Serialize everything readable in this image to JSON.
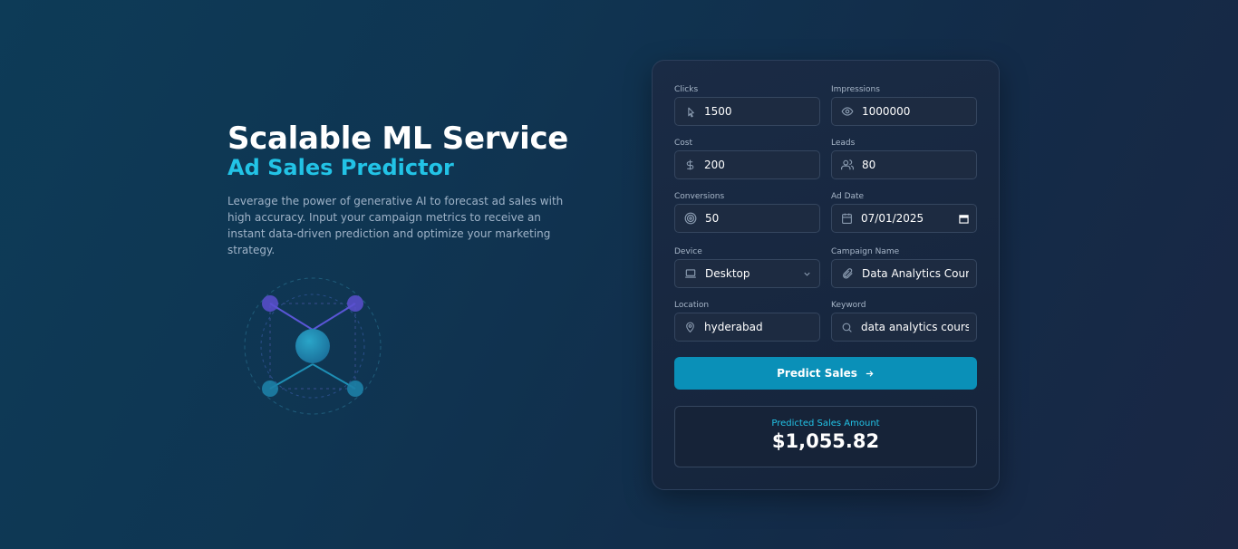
{
  "hero": {
    "title": "Scalable ML Service",
    "subtitle": "Ad Sales Predictor",
    "description": "Leverage the power of generative AI to forecast ad sales with high accuracy. Input your campaign metrics to receive an instant data-driven prediction and optimize your marketing strategy."
  },
  "form": {
    "clicks": {
      "label": "Clicks",
      "value": "1500",
      "icon": "pointer-icon"
    },
    "impressions": {
      "label": "Impressions",
      "value": "1000000",
      "icon": "eye-icon"
    },
    "cost": {
      "label": "Cost",
      "value": "200",
      "icon": "dollar-icon"
    },
    "leads": {
      "label": "Leads",
      "value": "80",
      "icon": "users-icon"
    },
    "conversions": {
      "label": "Conversions",
      "value": "50",
      "icon": "target-icon"
    },
    "ad_date": {
      "label": "Ad Date",
      "value": "07/01/2025",
      "icon": "calendar-icon"
    },
    "device": {
      "label": "Device",
      "value": "Desktop",
      "icon": "laptop-icon"
    },
    "campaign_name": {
      "label": "Campaign Name",
      "value": "Data Analytics Course",
      "icon": "paperclip-icon"
    },
    "location": {
      "label": "Location",
      "value": "hyderabad",
      "icon": "map-pin-icon"
    },
    "keyword": {
      "label": "Keyword",
      "value": "data analytics course",
      "icon": "search-icon"
    }
  },
  "predict_button": {
    "label": "Predict Sales"
  },
  "result": {
    "label": "Predicted Sales Amount",
    "value": "$1,055.82"
  },
  "colors": {
    "accent": "#22c3e6",
    "button": "#0a90b8",
    "card_bg": "#1a2b45",
    "field_border": "#35465f"
  }
}
